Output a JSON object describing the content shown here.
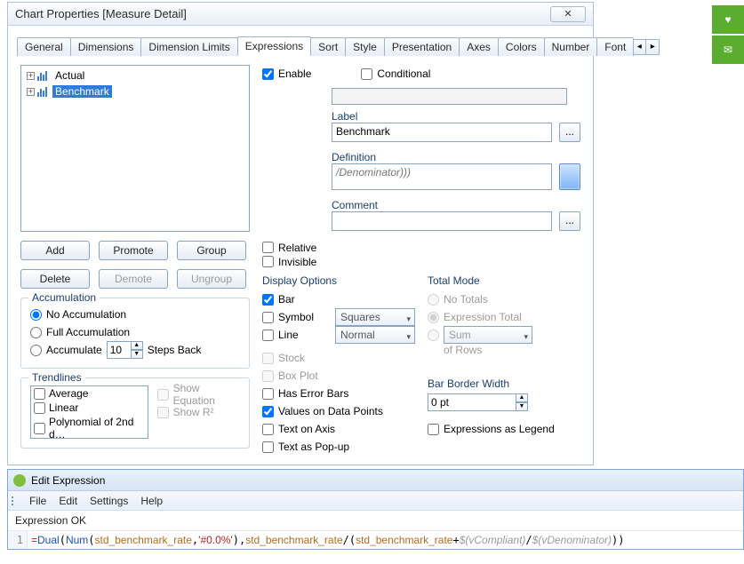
{
  "dialog": {
    "title": "Chart Properties [Measure Detail]",
    "close": "✕",
    "tabs": [
      "General",
      "Dimensions",
      "Dimension Limits",
      "Expressions",
      "Sort",
      "Style",
      "Presentation",
      "Axes",
      "Colors",
      "Number",
      "Font"
    ],
    "active_tab": 3,
    "tab_arrows": {
      "left": "◂",
      "right": "▸"
    }
  },
  "tree": {
    "items": [
      {
        "label": "Actual",
        "selected": false
      },
      {
        "label": "Benchmark",
        "selected": true
      }
    ]
  },
  "buttons": {
    "add": "Add",
    "promote": "Promote",
    "group": "Group",
    "delete": "Delete",
    "demote": "Demote",
    "ungroup": "Ungroup"
  },
  "accum": {
    "legend": "Accumulation",
    "none": "No Accumulation",
    "full": "Full Accumulation",
    "acc": "Accumulate",
    "steps_back": "Steps Back",
    "steps_value": "10"
  },
  "trend": {
    "legend": "Trendlines",
    "items": [
      "Average",
      "Linear",
      "Polynomial of 2nd d…"
    ],
    "show_eq": "Show Equation",
    "show_r2": "Show R²"
  },
  "right": {
    "enable": "Enable",
    "conditional": "Conditional",
    "label_label": "Label",
    "label_value": "Benchmark",
    "definition_label": "Definition",
    "definition_value": "/Denominator)))",
    "comment_label": "Comment",
    "relative": "Relative",
    "invisible": "Invisible",
    "ellipsis": "..."
  },
  "display": {
    "legend": "Display Options",
    "bar": "Bar",
    "symbol": "Symbol",
    "symbol_mode": "Squares Filled",
    "line": "Line",
    "line_mode": "Normal",
    "stock": "Stock",
    "box": "Box Plot",
    "error": "Has Error Bars",
    "values": "Values on Data Points",
    "text_axis": "Text on Axis",
    "text_popup": "Text as Pop-up"
  },
  "total": {
    "legend": "Total Mode",
    "none": "No Totals",
    "expr": "Expression Total",
    "sum": "Sum",
    "of_rows": "of Rows"
  },
  "border": {
    "label": "Bar Border Width",
    "value": "0 pt"
  },
  "expr_legend": "Expressions as Legend",
  "editexp": {
    "title": "Edit Expression",
    "menu": [
      "File",
      "Edit",
      "Settings",
      "Help"
    ],
    "status": "Expression OK",
    "line": "1"
  },
  "code": {
    "eq": "=",
    "dual": "Dual",
    "num": "Num",
    "id1": "std_benchmark_rate",
    "fmt": "'#0.0%'",
    "id2": "std_benchmark_rate",
    "id3": "std_benchmark_rate",
    "v1": "$(vCompliant)",
    "v2": "$(vDenominator)"
  },
  "side": {
    "heart": "♥",
    "mail": "✉"
  }
}
